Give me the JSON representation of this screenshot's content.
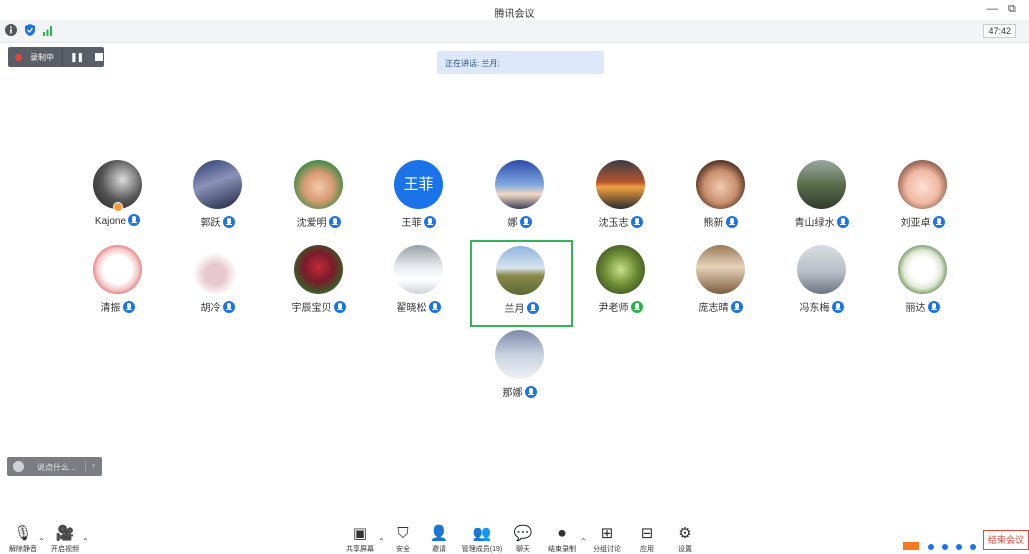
{
  "window": {
    "title": "腾讯会议",
    "minimize": "—",
    "restore": "⧉"
  },
  "status": {
    "timer": "47:42",
    "info_icon": "info-icon",
    "shield_icon": "shield-icon",
    "signal_icon": "signal-icon"
  },
  "recording": {
    "label": "录制中",
    "pause": "❚❚"
  },
  "speaking": {
    "text": "正在讲话: 兰月;"
  },
  "participants": [
    {
      "name": "Kajone"
    },
    {
      "name": "郭跃"
    },
    {
      "name": "沈爱明"
    },
    {
      "name": "王菲",
      "avatar_text": "王菲"
    },
    {
      "name": "娜"
    },
    {
      "name": "沈玉志"
    },
    {
      "name": "熊新"
    },
    {
      "name": "青山绿水"
    },
    {
      "name": "刘亚卓"
    },
    {
      "name": "清振"
    },
    {
      "name": "胡冷"
    },
    {
      "name": "宇辰宝贝"
    },
    {
      "name": "翟晓松"
    },
    {
      "name": "兰月"
    },
    {
      "name": "尹老师"
    },
    {
      "name": "庞志晴"
    },
    {
      "name": "冯东梅"
    },
    {
      "name": "丽达"
    },
    {
      "name": "那娜"
    }
  ],
  "chat": {
    "placeholder": "说点什么...",
    "arrow": "‹"
  },
  "toolbar": {
    "mute": "解除静音",
    "video": "开启视频",
    "share": "共享屏幕",
    "security": "安全",
    "invite": "邀请",
    "members": "管理成员(19)",
    "chat": "聊天",
    "record": "结束录制",
    "breakout": "分组讨论",
    "apps": "应用",
    "settings": "设置",
    "end": "结束会议"
  },
  "colors": {
    "accent": "#1a73e8",
    "active_border": "#35b35a",
    "end": "#e8453c"
  }
}
